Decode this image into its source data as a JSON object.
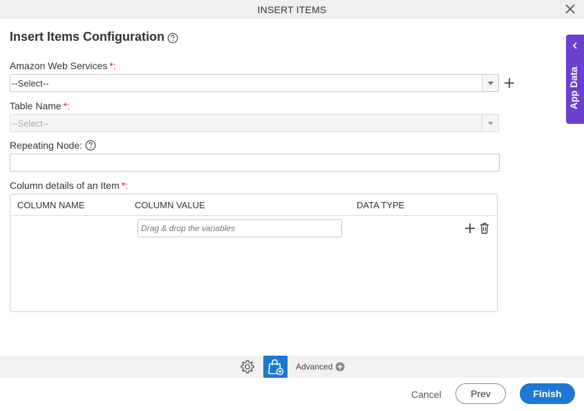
{
  "dialog": {
    "title": "INSERT ITEMS"
  },
  "config": {
    "heading": "Insert Items Configuration"
  },
  "fields": {
    "aws": {
      "label": "Amazon Web Services",
      "required": "*:",
      "value": "--Select--"
    },
    "table": {
      "label": "Table Name",
      "required": "*:",
      "value": "--Select--"
    },
    "repeating": {
      "label": "Repeating Node:",
      "value": ""
    },
    "columns": {
      "label": "Column details of an Item",
      "required": "*:"
    }
  },
  "grid": {
    "headers": [
      "COLUMN NAME",
      "COLUMN VALUE",
      "DATA TYPE"
    ],
    "row_placeholder": "Drag & drop the variables"
  },
  "footer": {
    "advanced_label": "Advanced",
    "cancel_label": "Cancel",
    "prev_label": "Prev",
    "finish_label": "Finish"
  },
  "side_panel": {
    "label": "App Data"
  },
  "colors": {
    "accent": "#1c78d3",
    "side_panel": "#6c3fcf",
    "required": "#cc2222"
  },
  "icons": [
    "close-icon",
    "help-icon",
    "plus-icon",
    "trash-icon",
    "gear-icon",
    "shopping-bag-plus-icon",
    "plus-circle-icon",
    "chevron-left-icon"
  ]
}
